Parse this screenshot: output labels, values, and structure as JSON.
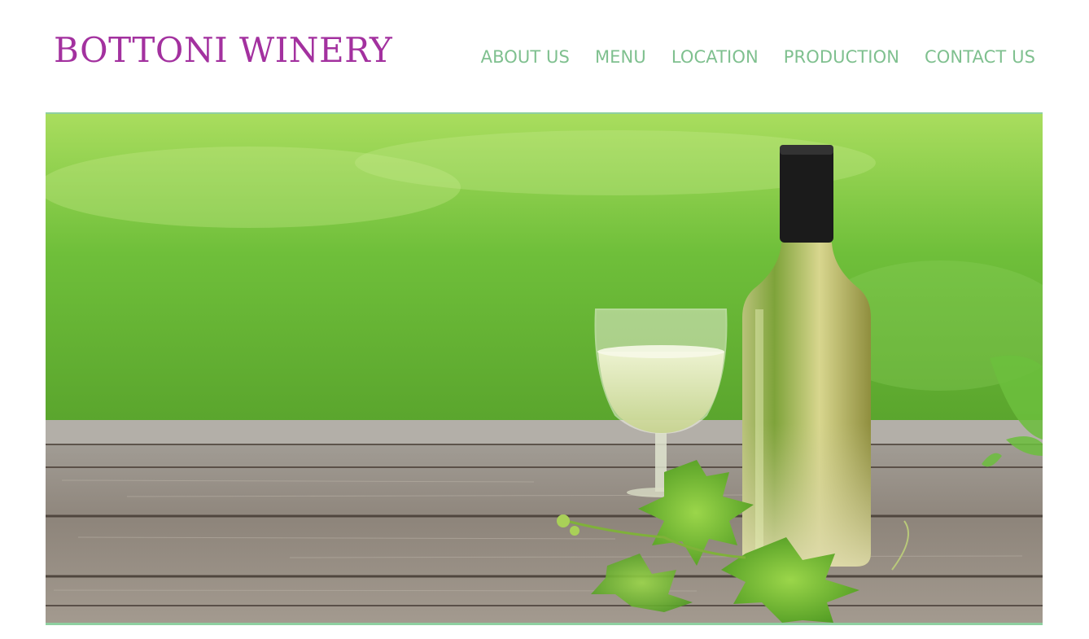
{
  "brand": {
    "name": "BOTTONI WINERY",
    "color": "#a3319f"
  },
  "nav": {
    "color": "#7fc08f",
    "items": [
      {
        "label": "ABOUT US"
      },
      {
        "label": "MENU"
      },
      {
        "label": "LOCATION"
      },
      {
        "label": "PRODUCTION"
      },
      {
        "label": "CONTACT US"
      }
    ]
  },
  "hero": {
    "subject": "white-wine-bottle-and-glass-with-grape-leaves-on-wooden-table",
    "accent_border": "#8ecfa0"
  }
}
